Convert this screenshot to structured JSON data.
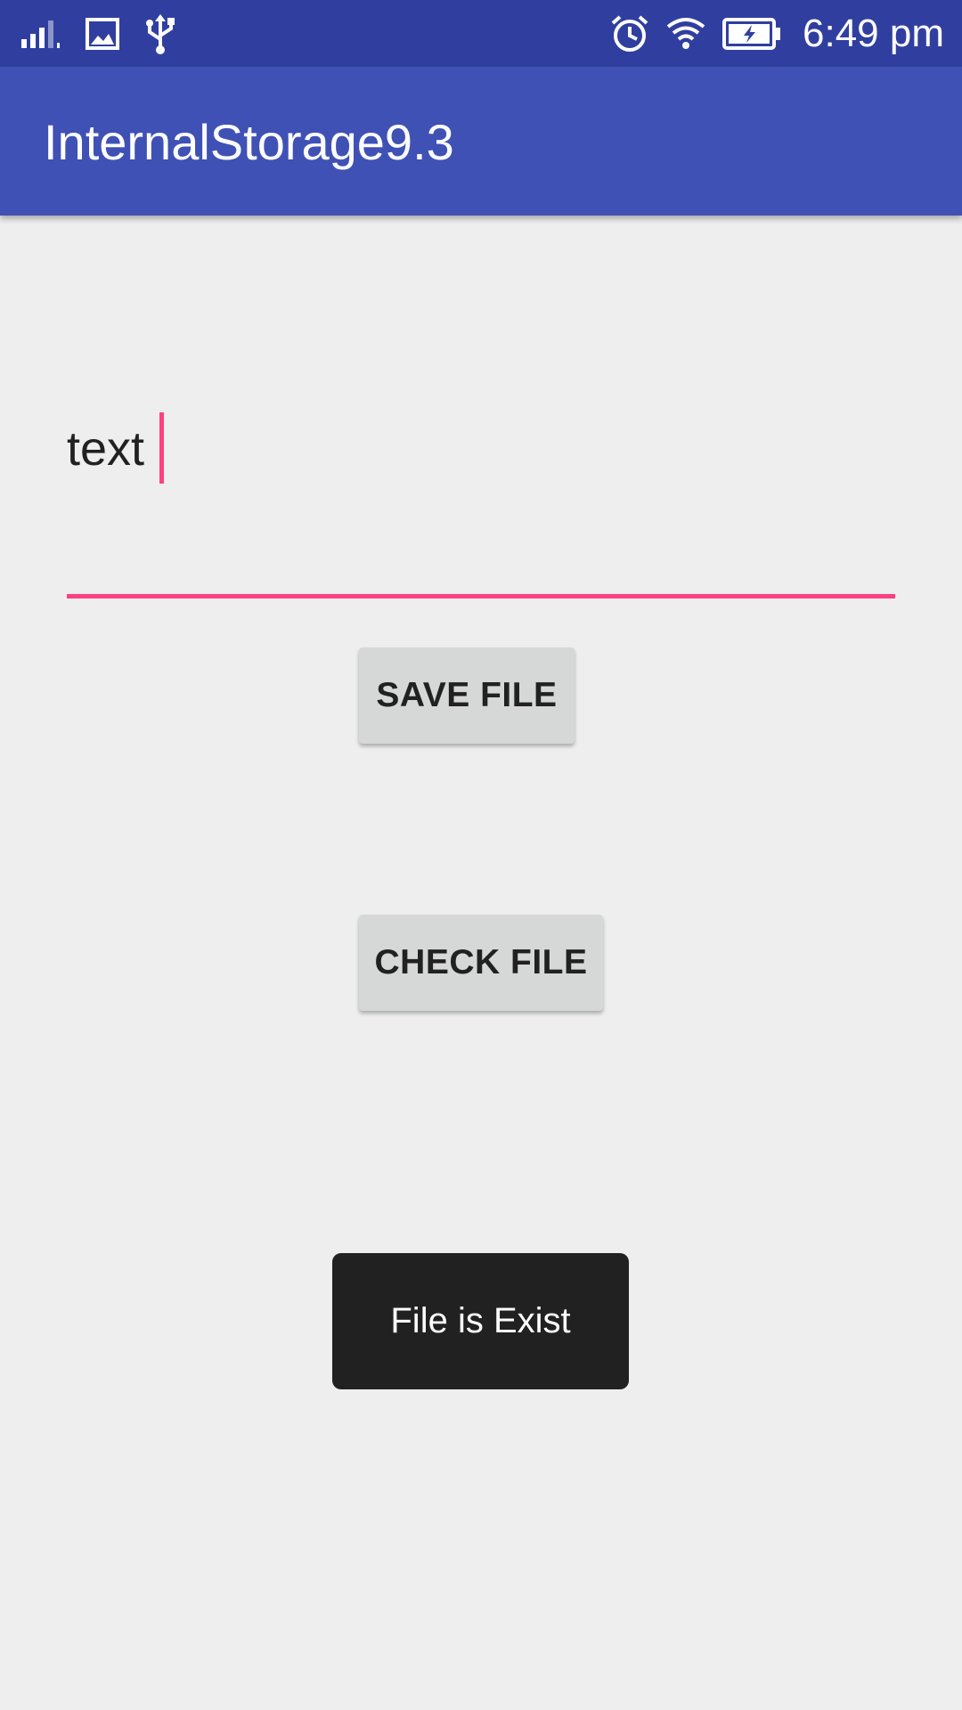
{
  "status_bar": {
    "time": "6:49 pm",
    "icons": [
      "signal-icon",
      "image-icon",
      "usb-icon",
      "alarm-icon",
      "wifi-icon",
      "battery-charging-icon"
    ],
    "background_color": "#303f9f"
  },
  "app_bar": {
    "title": "InternalStorage9.3",
    "background_color": "#3f51b5"
  },
  "edit_text": {
    "value": "text",
    "accent_color": "#ff4081"
  },
  "buttons": {
    "save_label": "SAVE FILE",
    "check_label": "CHECK FILE"
  },
  "toast": {
    "message": "File is Exist"
  }
}
